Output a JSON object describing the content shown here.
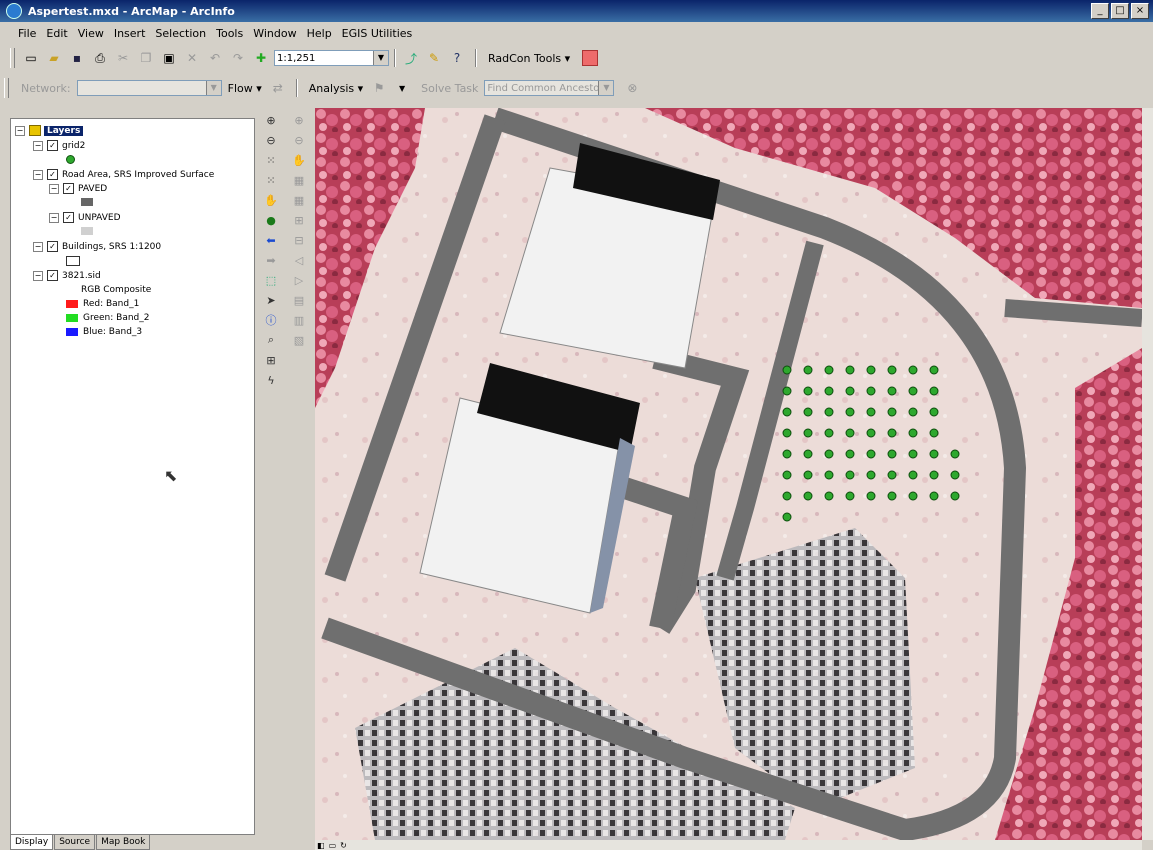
{
  "window": {
    "title": "Aspertest.mxd - ArcMap - ArcInfo"
  },
  "menu": [
    "File",
    "Edit",
    "View",
    "Insert",
    "Selection",
    "Tools",
    "Window",
    "Help",
    "EGIS Utilities"
  ],
  "toolbar_standard": {
    "scale": "1:1,251",
    "radcon_label": "RadCon Tools ▾",
    "icons": [
      "new-doc",
      "open",
      "save",
      "print",
      "cut",
      "copy",
      "paste",
      "delete",
      "undo",
      "redo",
      "add-data"
    ]
  },
  "toolbar_network": {
    "network_label": "Network:",
    "flow_label": "Flow ▾",
    "analysis_label": "Analysis ▾",
    "solve_label": "Solve Task",
    "task_combo": "Find Common Ancestors"
  },
  "toc": {
    "root": "Layers",
    "layers": [
      {
        "name": "grid2"
      },
      {
        "name": "Road Area, SRS Improved Surface",
        "sublayers": [
          "PAVED",
          "UNPAVED"
        ]
      },
      {
        "name": "Buildings, SRS 1:1200"
      },
      {
        "name": "3821.sid",
        "legend_title": "RGB Composite",
        "bands": [
          {
            "label": "Red:   Band_1",
            "color": "#ff1a1a"
          },
          {
            "label": "Green: Band_2",
            "color": "#22dd22"
          },
          {
            "label": "Blue:  Band_3",
            "color": "#1a1aff"
          }
        ]
      }
    ],
    "tabs": [
      "Display",
      "Source",
      "Map Book"
    ],
    "active_tab": "Display"
  },
  "map": {
    "grid_points_color": "#2ea82e",
    "grid_rows": [
      8,
      8,
      8,
      8,
      9,
      9,
      9,
      1
    ]
  }
}
